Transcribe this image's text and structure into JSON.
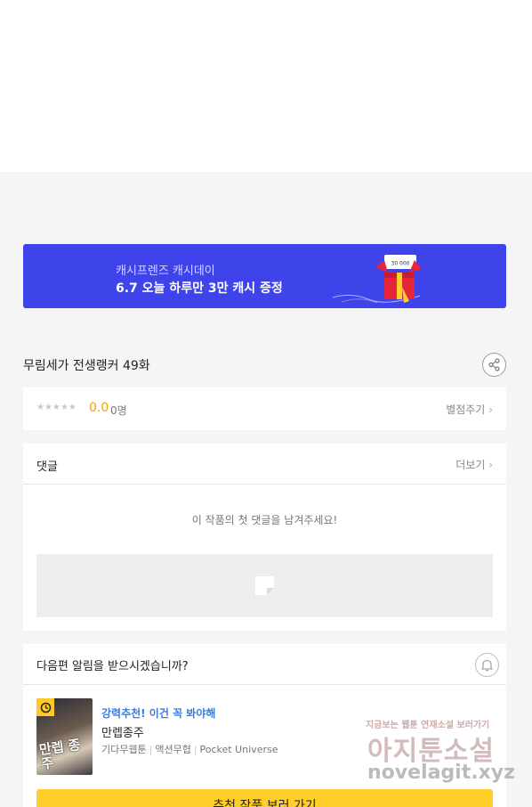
{
  "banner": {
    "subtitle": "캐시프렌즈 캐시데이",
    "title": "6.7 오늘 하루만 3만 캐시 증정",
    "gift_amount": "30 000"
  },
  "episode": {
    "title": "무림세가 전생랭커 49화"
  },
  "rating": {
    "stars": "★★★★★",
    "score": "0.0",
    "count": "0명",
    "rate_label": "별점주기"
  },
  "comments": {
    "heading": "댓글",
    "more_label": "더보기",
    "empty_message": "이 작품의 첫 댓글을 남겨주세요!"
  },
  "notify": {
    "question": "다음편 알림을 받으시겠습니까?"
  },
  "recommendation": {
    "tag": "강력추천! 이건 꼭 봐야해",
    "title": "만렙종주",
    "genre1": "기다무웹툰",
    "genre2": "액션무협",
    "publisher": "Pocket Universe",
    "thumb_text": "만렙 종주",
    "cta_label": "추천 작품 보러 가기"
  },
  "watermark": {
    "small": "지금보는 웹툰 연재소설 보러가기",
    "big": "아지툰소설",
    "url": "novelagit.xyz"
  },
  "colors": {
    "banner_bg": "#3e43ea",
    "score": "#f0a500",
    "tag": "#3b7dd8",
    "cta": "#ffce2b"
  },
  "icons": [
    "share-icon",
    "chevron-right-icon",
    "comment-placeholder-icon",
    "bell-icon",
    "clock-icon",
    "gift-box-icon"
  ]
}
